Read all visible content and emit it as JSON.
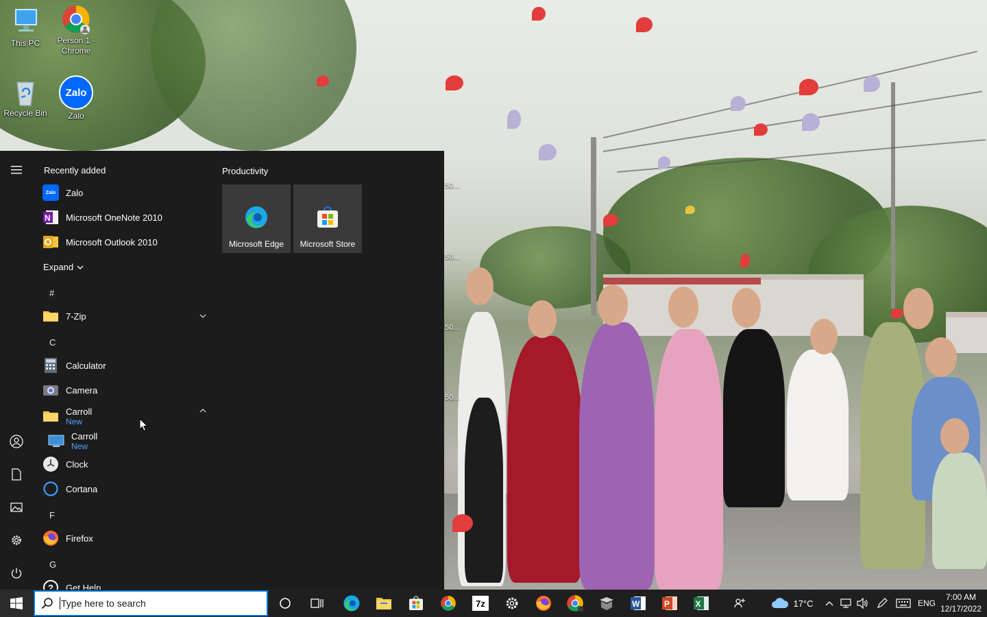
{
  "desktop": {
    "icons": [
      {
        "name": "this-pc",
        "label": "This PC"
      },
      {
        "name": "chrome",
        "label": "Person 1 - Chrome"
      },
      {
        "name": "recycle-bin",
        "label": "Recycle Bin"
      },
      {
        "name": "zalo",
        "label": "Zalo"
      }
    ],
    "zalo_logo_text": "Zalo",
    "partial_labels": [
      "50...",
      "50...",
      "50...",
      "50..."
    ]
  },
  "start_menu": {
    "recently_added_title": "Recently added",
    "recent": [
      {
        "label": "Zalo",
        "icon": "zalo-icon"
      },
      {
        "label": "Microsoft OneNote 2010",
        "icon": "onenote-icon"
      },
      {
        "label": "Microsoft Outlook 2010",
        "icon": "outlook-icon"
      }
    ],
    "expand_label": "Expand",
    "apps": {
      "letter_hash": "#",
      "seven_zip": "7-Zip",
      "letter_c": "C",
      "calculator": "Calculator",
      "camera": "Camera",
      "carroll_folder": "Carroll",
      "carroll_folder_badge": "New",
      "carroll_app": "Carroll",
      "carroll_app_badge": "New",
      "clock": "Clock",
      "cortana": "Cortana",
      "letter_f": "F",
      "firefox": "Firefox",
      "letter_g": "G",
      "get_help": "Get Help"
    },
    "tiles_group_title": "Productivity",
    "tiles": [
      {
        "label": "Microsoft Edge",
        "icon": "edge-icon"
      },
      {
        "label": "Microsoft Store",
        "icon": "store-icon"
      }
    ]
  },
  "taskbar": {
    "search_placeholder": "Type here to search",
    "pinned": [
      "cortana-icon",
      "task-view-icon",
      "edge-icon",
      "file-explorer-icon",
      "store-icon",
      "chrome-icon",
      "7zip-icon",
      "settings-icon",
      "firefox-icon",
      "chrome-profile-icon",
      "app-icon",
      "word-icon",
      "powerpoint-icon",
      "excel-icon"
    ],
    "sevenzip_text": "7z",
    "weather": "17°C",
    "language": "ENG",
    "time": "7:00 AM",
    "date": "12/17/2022"
  },
  "colors": {
    "start_bg": "#1c1c1c",
    "taskbar_bg": "#1f1f1f",
    "accent": "#0078d7",
    "new_badge": "#4fa3ff"
  }
}
